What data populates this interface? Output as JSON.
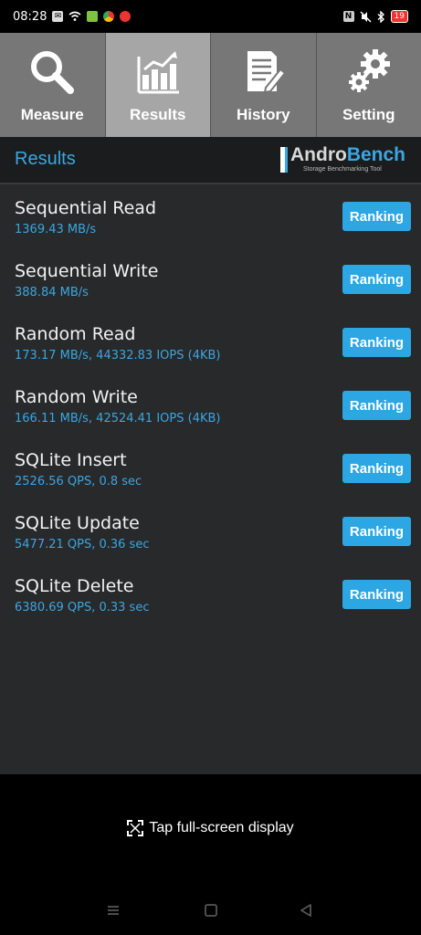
{
  "status": {
    "time": "08:28",
    "battery": "19"
  },
  "tabs": [
    {
      "label": "Measure",
      "icon": "magnifier-icon"
    },
    {
      "label": "Results",
      "icon": "bar-chart-icon"
    },
    {
      "label": "History",
      "icon": "document-edit-icon"
    },
    {
      "label": "Setting",
      "icon": "gears-icon"
    }
  ],
  "header": {
    "title": "Results",
    "logo_part1": "Andro",
    "logo_part2": "Bench",
    "logo_sub": "Storage Benchmarking Tool"
  },
  "results": [
    {
      "name": "Sequential Read",
      "value": "1369.43 MB/s",
      "button": "Ranking"
    },
    {
      "name": "Sequential Write",
      "value": "388.84 MB/s",
      "button": "Ranking"
    },
    {
      "name": "Random Read",
      "value": "173.17 MB/s, 44332.83 IOPS (4KB)",
      "button": "Ranking"
    },
    {
      "name": "Random Write",
      "value": "166.11 MB/s, 42524.41 IOPS (4KB)",
      "button": "Ranking"
    },
    {
      "name": "SQLite Insert",
      "value": "2526.56 QPS, 0.8 sec",
      "button": "Ranking"
    },
    {
      "name": "SQLite Update",
      "value": "5477.21 QPS, 0.36 sec",
      "button": "Ranking"
    },
    {
      "name": "SQLite Delete",
      "value": "6380.69 QPS, 0.33 sec",
      "button": "Ranking"
    }
  ],
  "footer": {
    "fullscreen_label": "Tap full-screen display"
  },
  "colors": {
    "accent": "#39a7e3",
    "tab": "#777777",
    "tab_active": "#a6a6a6",
    "list_bg": "#28292a"
  }
}
